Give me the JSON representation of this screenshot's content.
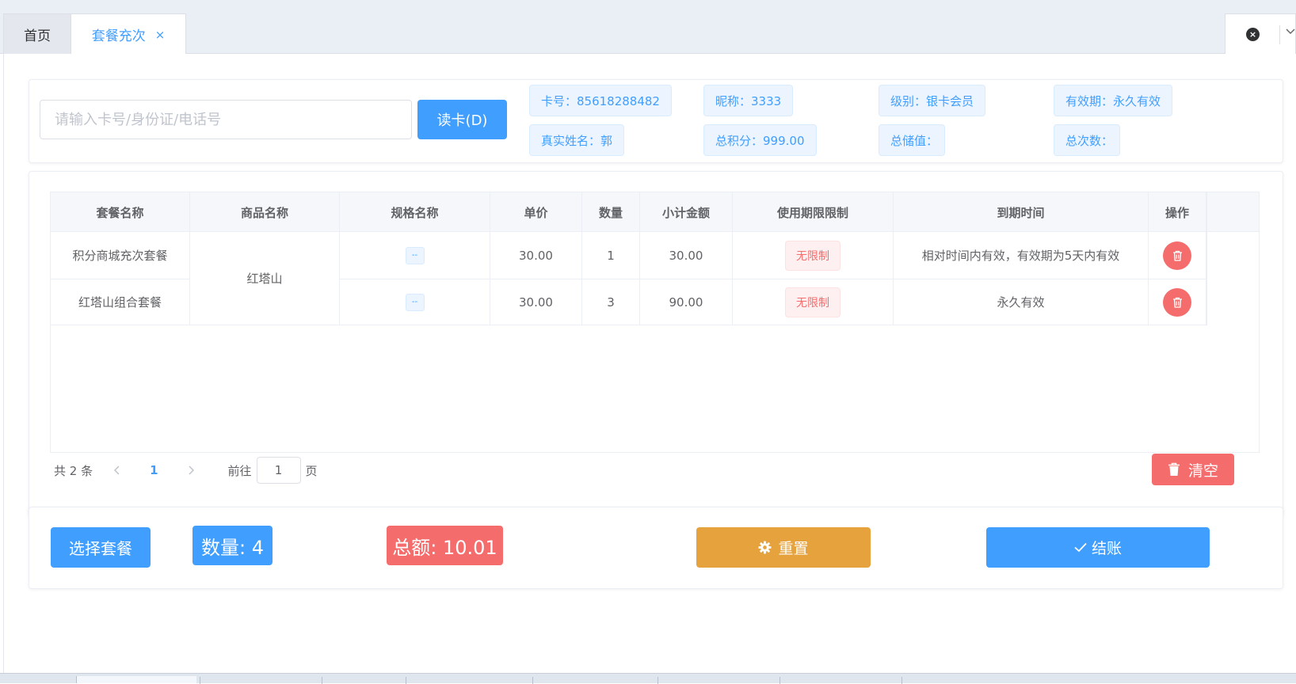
{
  "tabs": {
    "home_label": "首页",
    "active_label": "套餐充次",
    "close_glyph": "×"
  },
  "member": {
    "search_placeholder": "请输入卡号/身份证/电话号",
    "read_card_label": "读卡(D)",
    "card_no": "卡号：85618288482",
    "nickname": "昵称：3333",
    "level": "级别：银卡会员",
    "validity": "有效期：永久有效",
    "real_name": "真实姓名：郭",
    "total_points": "总积分：999.00",
    "total_stored": "总储值：",
    "total_times": "总次数："
  },
  "table": {
    "headers": [
      "套餐名称",
      "商品名称",
      "规格名称",
      "单价",
      "数量",
      "小计金额",
      "使用期限限制",
      "到期时间",
      "操作"
    ],
    "rows": [
      {
        "package": "积分商城充次套餐",
        "spec": "--",
        "price": "30.00",
        "qty": "1",
        "subtotal": "30.00",
        "limit": "无限制",
        "expiry": "相对时间内有效，有效期为5天内有效"
      },
      {
        "package": "红塔山组合套餐",
        "spec": "--",
        "price": "30.00",
        "qty": "3",
        "subtotal": "90.00",
        "limit": "无限制",
        "expiry": "永久有效"
      }
    ],
    "merged_product": "红塔山"
  },
  "pagination": {
    "total_text": "共 2 条",
    "current_page": "1",
    "goto_label": "前往",
    "goto_value": "1",
    "page_suffix": "页"
  },
  "actions": {
    "clear_label": "清空",
    "select_package_label": "选择套餐",
    "quantity_label": "数量: 4",
    "total_label": "总额: 10.01",
    "reset_label": "重置",
    "checkout_label": "结账"
  },
  "colors": {
    "primary": "#409eff",
    "danger": "#f56c6c",
    "warning": "#e6a23c"
  }
}
